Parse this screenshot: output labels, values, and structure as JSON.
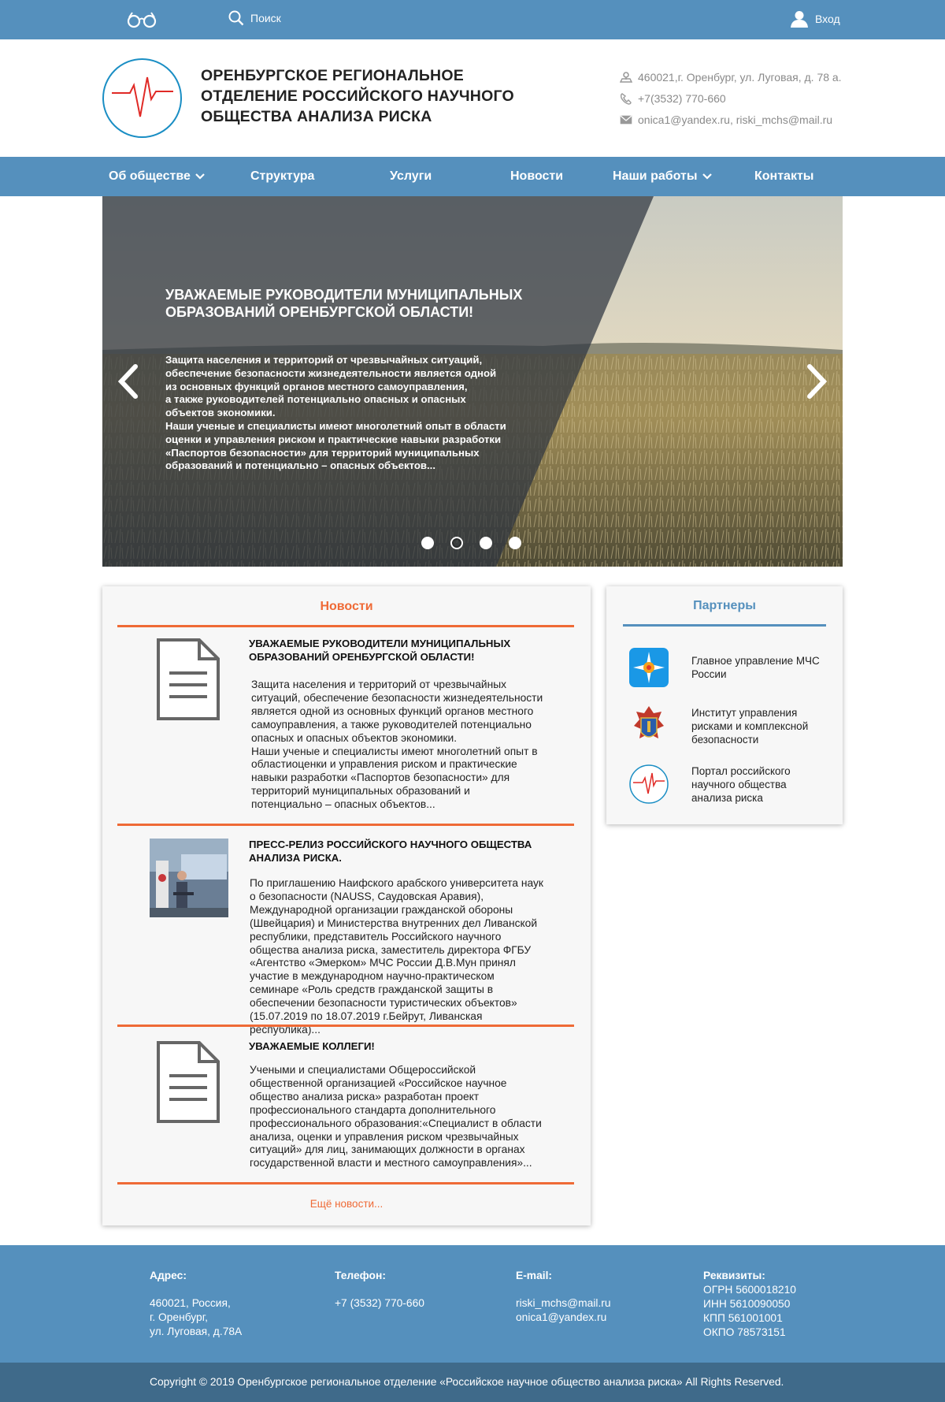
{
  "topbar": {
    "search_label": "Поиск",
    "login_label": "Вход",
    "icons": [
      "glasses-icon",
      "search-icon",
      "user-icon"
    ]
  },
  "header": {
    "title_line1": "ОРЕНБУРГСКОЕ РЕГИОНАЛЬНОЕ",
    "title_line2": "ОТДЕЛЕНИЕ РОССИЙСКОГО НАУЧНОГО",
    "title_line3": "ОБЩЕСТВА АНАЛИЗА РИСКА",
    "address": "460021,г. Оренбург, ул. Луговая, д. 78 а.",
    "phone": "+7(3532) 770-660",
    "email": "onica1@yandex.ru, riski_mchs@mail.ru"
  },
  "nav": {
    "items": [
      {
        "label": "Об обществе",
        "dropdown": true
      },
      {
        "label": "Структура"
      },
      {
        "label": "Услуги"
      },
      {
        "label": "Новости"
      },
      {
        "label": "Наши работы",
        "dropdown": true
      },
      {
        "label": "Контакты"
      }
    ]
  },
  "hero": {
    "title": "УВАЖАЕМЫЕ РУКОВОДИТЕЛИ МУНИЦИПАЛЬНЫХ ОБРАЗОВАНИЙ ОРЕНБУРГСКОЙ ОБЛАСТИ!",
    "text": "Защита населения и территорий от чрезвычайных ситуаций,\nобеспечение безопасности жизнедеятельности является одной\nиз основных функций органов местного самоуправления,\nа также руководителей потенциально опасных и опасных\nобъектов экономики.\nНаши ученые и специалисты имеют многолетний опыт в области\nоценки и управления риском и практические навыки разработки\n«Паспортов безопасности» для территорий муниципальных\nобразований и потенциально – опасных объектов...",
    "slide_count": 4,
    "active_slide": 2
  },
  "news": {
    "title": "Новости",
    "items": [
      {
        "title": "УВАЖАЕМЫЕ РУКОВОДИТЕЛИ МУНИЦИПАЛЬНЫХ ОБРАЗОВАНИЙ ОРЕНБУРГСКОЙ ОБЛАСТИ!",
        "thumb": "document-icon",
        "body": "Защита населения и территорий от чрезвычайных ситуаций, обеспечение безопасности жизнедеятельности является одной из основных функций органов местного самоуправления, а также руководителей потенциально опасных и опасных объектов экономики.\nНаши ученые и специалисты имеют многолетний опыт в областиоценки и управления риском и практические навыки разработки «Паспортов безопасности» для территорий муниципальных образований и потенциально – опасных объектов..."
      },
      {
        "title": "ПРЕСС-РЕЛИЗ РОССИЙСКОГО НАУЧНОГО ОБЩЕСТВА АНАЛИЗА РИСКА.",
        "thumb": "photo",
        "body": "По приглашению Наифского арабского университета наук о безопасности (NAUSS, Саудовская Аравия), Международной организации гражданской обороны (Швейцария) и Министерства внутренних дел Ливанской республики, представитель Российского научного общества анализа риска, заместитель директора ФГБУ «Агентство «Эмерком» МЧС России Д.В.Мун принял участие в международном научно-практическом семинаре «Роль средств гражданской защиты в обеспечении безопасности туристических объектов» (15.07.2019 по 18.07.2019 г.Бейрут, Ливанская республика)..."
      },
      {
        "title": "УВАЖАЕМЫЕ КОЛЛЕГИ!",
        "thumb": "document-icon",
        "body": "Учеными и специалистами Общероссийской общественной организацией «Российское научное общество анализа риска» разработан проект профессионального стандарта дополнительного профессионального образования:«Специалист в области анализа, оценки и управления риском чрезвычайных ситуаций» для лиц, занимающих должности в органах государственной власти и местного самоуправления»..."
      }
    ],
    "more_label": "Ещё новости..."
  },
  "partners": {
    "title": "Партнеры",
    "items": [
      {
        "label": "Главное управление МЧС России",
        "icon": "mchs-emblem-icon"
      },
      {
        "label": "Институт управления рисками и комплексной безопасности",
        "icon": "institute-emblem-icon"
      },
      {
        "label": "Портал российского научного общества анализа риска",
        "icon": "risk-society-logo-icon"
      }
    ]
  },
  "footer": {
    "address_title": "Адрес:",
    "address_lines": [
      "460021, Россия,",
      "г. Оренбург,",
      "ул. Луговая, д.78А"
    ],
    "phone_title": "Телефон:",
    "phone": "+7 (3532) 770-660",
    "email_title": "E-mail:",
    "emails": [
      "riski_mchs@mail.ru",
      "onica1@yandex.ru"
    ],
    "requisites_title": "Реквизиты:",
    "requisites": [
      "ОГРН 5600018210",
      "ИНН 5610090050",
      "КПП 561001001",
      "ОКПО 78573151"
    ],
    "copyright": "Copyright © 2019 Оренбургское региональное отделение «Российское научное общество анализа риска» All Rights Reserved."
  },
  "colors": {
    "brand_blue": "#5590bd",
    "accent_orange": "#ef6a36",
    "footer_dark": "#3f6a8a"
  }
}
